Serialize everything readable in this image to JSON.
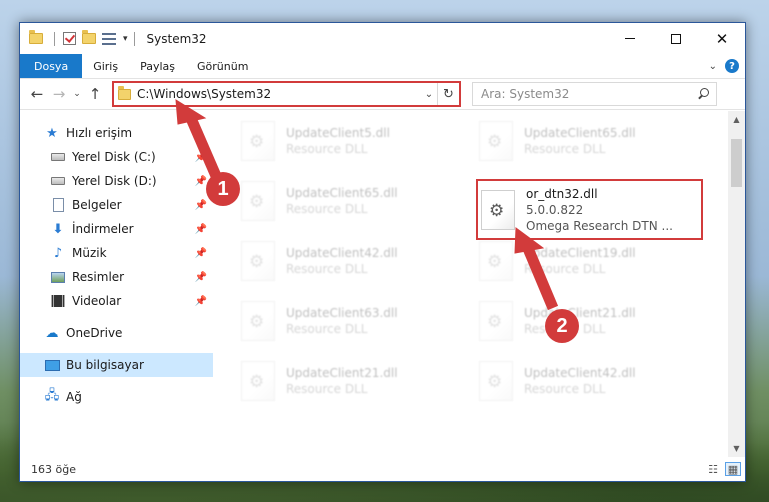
{
  "window": {
    "title": "System32"
  },
  "ribbon": {
    "tabs": [
      "Dosya",
      "Giriş",
      "Paylaş",
      "Görünüm"
    ],
    "help": "?"
  },
  "navbar": {
    "back": "←",
    "forward": "→",
    "recent": "⌄",
    "up": "↑",
    "address": "C:\\Windows\\System32",
    "search_placeholder": "Ara: System32"
  },
  "sidebar": {
    "items": [
      {
        "label": "Hızlı erişim",
        "icon": "star-icon"
      },
      {
        "label": "Yerel Disk (C:)",
        "icon": "disk-icon",
        "pinned": true
      },
      {
        "label": "Yerel Disk (D:)",
        "icon": "disk-icon",
        "pinned": true
      },
      {
        "label": "Belgeler",
        "icon": "document-icon",
        "pinned": true
      },
      {
        "label": "İndirmeler",
        "icon": "download-icon",
        "pinned": true
      },
      {
        "label": "Müzik",
        "icon": "music-icon",
        "pinned": true
      },
      {
        "label": "Resimler",
        "icon": "pictures-icon",
        "pinned": true
      },
      {
        "label": "Videolar",
        "icon": "videos-icon",
        "pinned": true
      },
      {
        "label": "OneDrive",
        "icon": "cloud-icon"
      },
      {
        "label": "Bu bilgisayar",
        "icon": "computer-icon",
        "selected": true
      },
      {
        "label": "Ağ",
        "icon": "network-icon"
      }
    ]
  },
  "files": {
    "left_column": [
      {
        "name": "UpdateClient5.dll",
        "type": "Resource DLL"
      },
      {
        "name": "UpdateClient65.dll",
        "type": "Resource DLL"
      },
      {
        "name": "UpdateClient42.dll",
        "type": "Resource DLL"
      },
      {
        "name": "UpdateClient63.dll",
        "type": "Resource DLL"
      },
      {
        "name": "UpdateClient21.dll",
        "type": "Resource DLL"
      }
    ],
    "right_column": [
      {
        "name": "UpdateClient65.dll",
        "type": "Resource DLL"
      },
      {
        "name": "or_dtn32.dll",
        "version": "5.0.0.822",
        "company": "Omega Research DTN ..."
      },
      {
        "name": "UpdateClient19.dll",
        "type": "Resource DLL"
      },
      {
        "name": "UpdateClient21.dll",
        "type": "Resource DLL"
      },
      {
        "name": "UpdateClient42.dll",
        "type": "Resource DLL"
      }
    ]
  },
  "status": {
    "count": "163 öğe"
  },
  "callouts": [
    "1",
    "2"
  ],
  "colors": {
    "accent": "#1979ca",
    "highlight": "#d23b3b",
    "selected_bg": "#cce8ff"
  }
}
